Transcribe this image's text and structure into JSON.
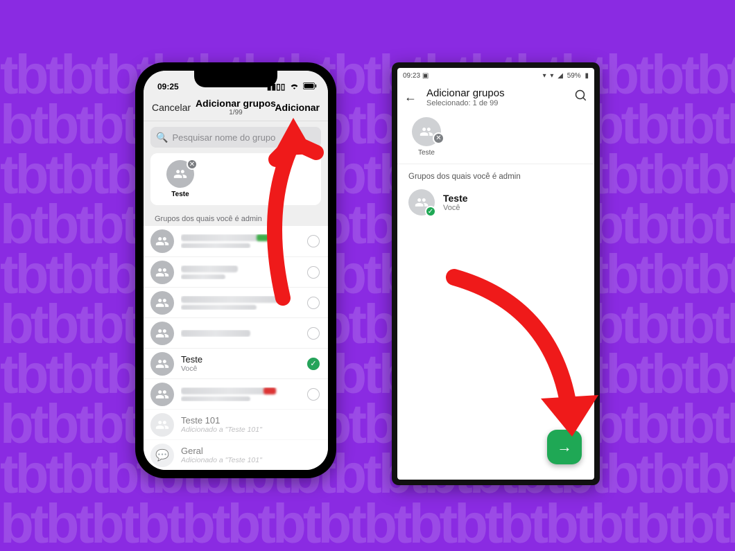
{
  "background": {
    "color": "#8a2be2",
    "watermark_text": "tb"
  },
  "annotations": {
    "arrow_ios_target": "adicionar-button",
    "arrow_android_target": "fab-next"
  },
  "ios": {
    "status": {
      "time": "09:25",
      "signal_icon": "cellular-icon",
      "wifi_icon": "wifi-icon",
      "battery_icon": "battery-icon"
    },
    "nav": {
      "cancel_label": "Cancelar",
      "title": "Adicionar grupos",
      "subtitle": "1/99",
      "add_label": "Adicionar"
    },
    "search": {
      "placeholder": "Pesquisar nome do grupo"
    },
    "selected_chip": {
      "label": "Teste",
      "remove_icon": "close-icon"
    },
    "section_title": "Grupos dos quais você é admin",
    "rows": [
      {
        "name_censored": true,
        "checked": false,
        "accent": "green"
      },
      {
        "name_censored": true,
        "checked": false
      },
      {
        "name_censored": true,
        "checked": false
      },
      {
        "name_censored": true,
        "checked": false
      },
      {
        "name": "Teste",
        "sub": "Você",
        "checked": true
      },
      {
        "name_censored": true,
        "checked": false,
        "accent": "red"
      },
      {
        "name": "Teste 101",
        "sub": "Adicionado a \"Teste 101\"",
        "disabled": true
      },
      {
        "name": "Geral",
        "sub": "Adicionado a \"Teste 101\"",
        "disabled": true
      }
    ]
  },
  "android": {
    "status": {
      "time": "09:23",
      "battery_text": "59%"
    },
    "header": {
      "back_icon": "arrow-left-icon",
      "title": "Adicionar grupos",
      "subtitle": "Selecionado: 1 de 99",
      "search_icon": "search-icon"
    },
    "selected_chip": {
      "label": "Teste",
      "remove_icon": "close-icon"
    },
    "section_title": "Grupos dos quais você é admin",
    "rows": [
      {
        "name": "Teste",
        "sub": "Você",
        "checked": true
      }
    ],
    "fab_icon": "arrow-right-icon"
  }
}
